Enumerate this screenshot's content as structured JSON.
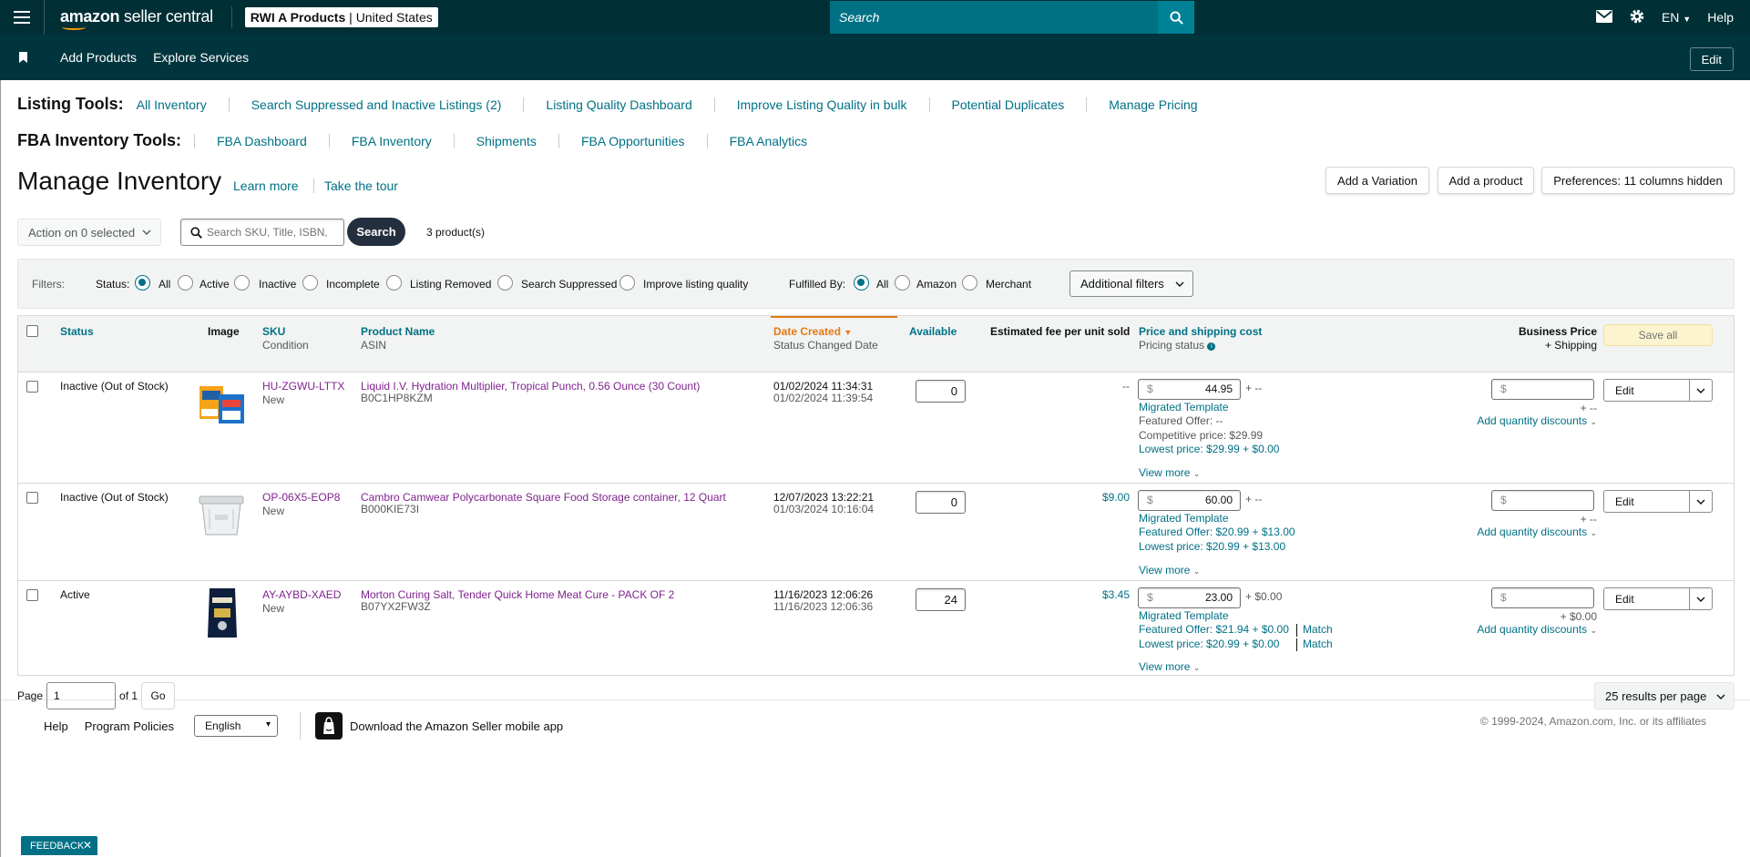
{
  "topbar": {
    "logo_prefix": "amazon",
    "logo_suffix": "seller central",
    "store_name": "RWI A Products",
    "store_region": "United States",
    "search_placeholder": "Search",
    "language": "EN",
    "help": "Help",
    "icons": [
      "menu-icon",
      "search-icon",
      "mail-icon",
      "gear-icon",
      "chevron-down-icon"
    ]
  },
  "navbar": {
    "links": [
      "Add Products",
      "Explore Services"
    ],
    "edit": "Edit"
  },
  "listing_tools": {
    "title": "Listing Tools:",
    "links": [
      "All Inventory",
      "Search Suppressed and Inactive Listings (2)",
      "Listing Quality Dashboard",
      "Improve Listing Quality in bulk",
      "Potential Duplicates",
      "Manage Pricing"
    ]
  },
  "fba_tools": {
    "title": "FBA Inventory Tools:",
    "links": [
      "FBA Dashboard",
      "FBA Inventory",
      "Shipments",
      "FBA Opportunities",
      "FBA Analytics"
    ]
  },
  "header": {
    "title": "Manage Inventory",
    "learn_more": "Learn more",
    "take_tour": "Take the tour",
    "add_variation": "Add a Variation",
    "add_product": "Add a product",
    "preferences": "Preferences: 11 columns hidden"
  },
  "actions": {
    "action_select": "Action on 0 selected",
    "search_placeholder": "Search SKU, Title, ISBN,",
    "search_button": "Search",
    "product_count": "3 product(s)"
  },
  "filters": {
    "label": "Filters:",
    "status_label": "Status:",
    "status_options": [
      "All",
      "Active",
      "Inactive",
      "Incomplete",
      "Listing Removed",
      "Search Suppressed",
      "Improve listing quality"
    ],
    "status_selected": "All",
    "fulfilled_label": "Fulfilled By:",
    "fulfilled_options": [
      "All",
      "Amazon",
      "Merchant"
    ],
    "fulfilled_selected": "All",
    "additional": "Additional filters"
  },
  "table": {
    "columns": {
      "status": "Status",
      "image": "Image",
      "sku": "SKU",
      "condition": "Condition",
      "product_name": "Product Name",
      "asin": "ASIN",
      "date_created": "Date Created",
      "status_changed": "Status Changed Date",
      "available": "Available",
      "fee": "Estimated fee per unit sold",
      "price": "Price and shipping cost",
      "pricing_status": "Pricing status",
      "business_price": "Business Price",
      "plus_shipping": "+ Shipping",
      "save_all": "Save all"
    },
    "rows": [
      {
        "status": "Inactive (Out of Stock)",
        "sku": "HU-ZGWU-LTTX",
        "condition": "New",
        "name": "Liquid I.V. Hydration Multiplier, Tropical Punch, 0.56 Ounce (30 Count)",
        "asin": "B0C1HP8KZM",
        "created": "01/02/2024 11:34:31",
        "changed": "01/02/2024 11:39:54",
        "available": "0",
        "fee": "--",
        "price_currency": "$",
        "price": "44.95",
        "shipping": "+ --",
        "template": "Migrated Template",
        "featured": "Featured Offer: --",
        "competitive": "Competitive price: $29.99",
        "lowest": "Lowest price: $29.99 + $0.00",
        "view_more": "View more",
        "business_currency": "$",
        "business_shipping": "+ --",
        "qty_discounts": "Add quantity discounts",
        "edit": "Edit"
      },
      {
        "status": "Inactive (Out of Stock)",
        "sku": "OP-06X5-EOP8",
        "condition": "New",
        "name": "Cambro Camwear Polycarbonate Square Food Storage container, 12 Quart",
        "asin": "B000KIE73I",
        "created": "12/07/2023 13:22:21",
        "changed": "01/03/2024 10:16:04",
        "available": "0",
        "fee": "$9.00",
        "price_currency": "$",
        "price": "60.00",
        "shipping": "+ --",
        "template": "Migrated Template",
        "featured": "Featured Offer: $20.99 + $13.00",
        "lowest": "Lowest price: $20.99 + $13.00",
        "view_more": "View more",
        "business_currency": "$",
        "business_shipping": "+ --",
        "qty_discounts": "Add quantity discounts",
        "edit": "Edit"
      },
      {
        "status": "Active",
        "sku": "AY-AYBD-XAED",
        "condition": "New",
        "name": "Morton Curing Salt, Tender Quick Home Meat Cure - PACK OF 2",
        "asin": "B07YX2FW3Z",
        "created": "11/16/2023 12:06:26",
        "changed": "11/16/2023 12:06:36",
        "available": "24",
        "fee": "$3.45",
        "price_currency": "$",
        "price": "23.00",
        "shipping": "+ $0.00",
        "template": "Migrated Template",
        "featured": "Featured Offer: $21.94 + $0.00",
        "lowest": "Lowest price: $20.99 + $0.00",
        "match": "Match",
        "view_more": "View more",
        "business_currency": "$",
        "business_shipping": "+ $0.00",
        "qty_discounts": "Add quantity discounts",
        "edit": "Edit"
      }
    ]
  },
  "pagination": {
    "page_label": "Page",
    "page_value": "1",
    "of_label": "of 1",
    "go": "Go",
    "per_page": "25 results per page"
  },
  "footer": {
    "help": "Help",
    "policies": "Program Policies",
    "language": "English",
    "app_text": "Download the Amazon Seller mobile app",
    "copyright": "© 1999-2024, Amazon.com, Inc. or its affiliates"
  },
  "feedback": "FEEDBACK",
  "colors": {
    "header_bg": "#002f36",
    "nav_bg": "#00353e",
    "link": "#007185",
    "product_link": "#80248f",
    "sort_accent": "#e47911"
  }
}
